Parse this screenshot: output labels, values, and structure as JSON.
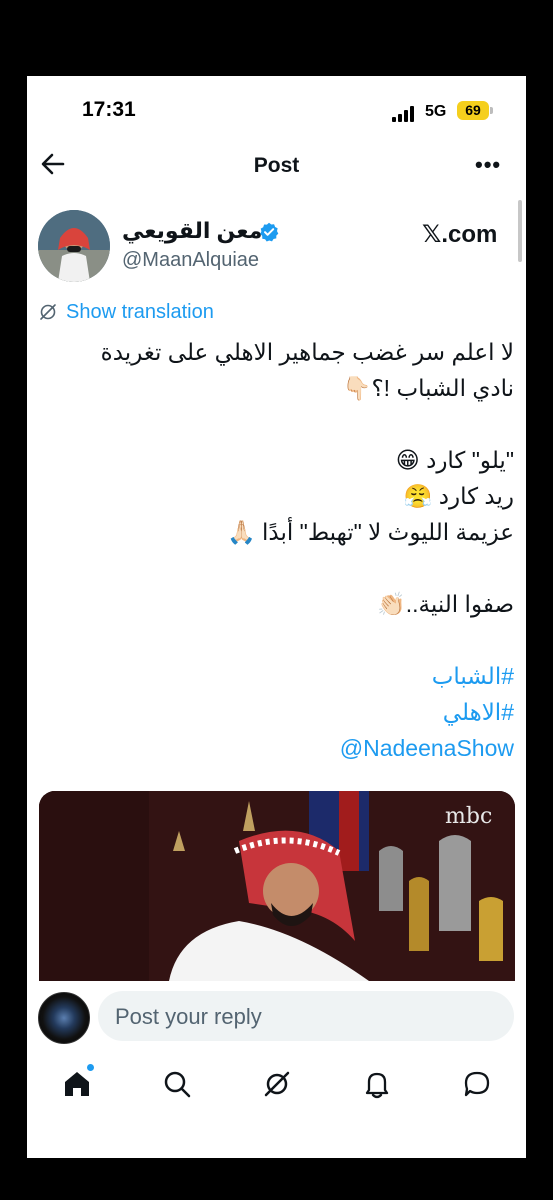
{
  "status_bar": {
    "time": "17:31",
    "network": "5G",
    "battery": "69",
    "battery_color": "#f5cf1d"
  },
  "header": {
    "title": "Post",
    "back_icon": "arrow-left-icon",
    "more_label": "•••"
  },
  "author": {
    "display_name": "معن القويعي",
    "handle": "@MaanAlquiae",
    "verified": true,
    "verified_color": "#1d9bf0"
  },
  "brand_label": "𝕏.com",
  "translation": {
    "label": "Show translation"
  },
  "tweet": {
    "lines": [
      "لا اعلم سر غضب جماهير الاهلي على تغريدة",
      "نادي الشباب !؟👇🏻",
      "",
      "\"يلو\" كارد 😁",
      "ريد كارد 😤",
      "عزيمة الليوث لا \"تهبط\" أبدًا 🙏🏻",
      "",
      "صفوا النية..👏🏻"
    ],
    "hashtags": [
      "#الشباب",
      "#الاهلي"
    ],
    "mention": "@NadeenaShow"
  },
  "media": {
    "watermark": "mbc"
  },
  "reply": {
    "placeholder": "Post your reply"
  },
  "bottom_nav": {
    "items": [
      "home-icon",
      "search-icon",
      "grok-icon",
      "notifications-icon",
      "messages-icon"
    ],
    "accent": "#1d9bf0"
  }
}
